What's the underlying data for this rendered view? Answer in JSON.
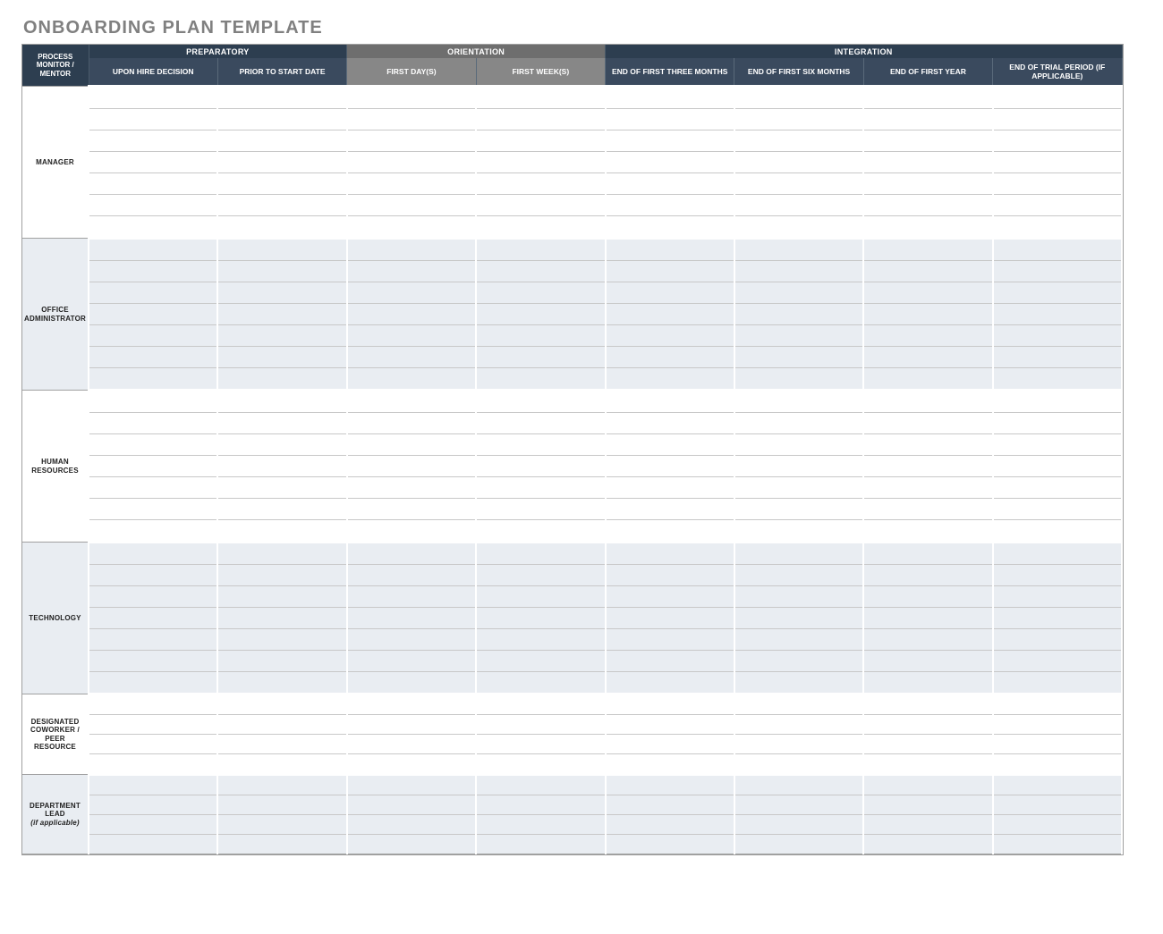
{
  "title": "ONBOARDING PLAN TEMPLATE",
  "corner_header": "PROCESS MONITOR / MENTOR",
  "phases": {
    "preparatory": "PREPARATORY",
    "orientation": "ORIENTATION",
    "integration": "INTEGRATION"
  },
  "stage_columns": [
    {
      "label": "UPON HIRE DECISION",
      "phase": "preparatory"
    },
    {
      "label": "PRIOR TO START DATE",
      "phase": "preparatory"
    },
    {
      "label": "FIRST DAY(S)",
      "phase": "orientation"
    },
    {
      "label": "FIRST WEEK(S)",
      "phase": "orientation"
    },
    {
      "label": "END OF FIRST THREE MONTHS",
      "phase": "integration"
    },
    {
      "label": "END OF FIRST SIX MONTHS",
      "phase": "integration"
    },
    {
      "label": "END OF FIRST YEAR",
      "phase": "integration"
    },
    {
      "label": "END OF TRIAL PERIOD (if applicable)",
      "phase": "integration"
    }
  ],
  "role_rows": [
    {
      "label": "MANAGER",
      "sublabel": "",
      "rows": 7,
      "shaded": false
    },
    {
      "label": "OFFICE ADMINISTRATOR",
      "sublabel": "",
      "rows": 7,
      "shaded": true
    },
    {
      "label": "HUMAN RESOURCES",
      "sublabel": "",
      "rows": 7,
      "shaded": false
    },
    {
      "label": "TECHNOLOGY",
      "sublabel": "",
      "rows": 7,
      "shaded": true
    },
    {
      "label": "DESIGNATED COWORKER / PEER RESOURCE",
      "sublabel": "",
      "rows": 4,
      "shaded": false
    },
    {
      "label": "DEPARTMENT LEAD",
      "sublabel": "(if applicable)",
      "rows": 4,
      "shaded": true
    }
  ]
}
